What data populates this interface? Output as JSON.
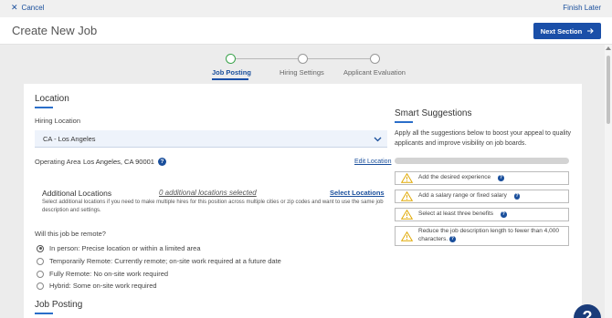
{
  "topbar": {
    "cancel_label": "Cancel",
    "finish_label": "Finish Later"
  },
  "header": {
    "title": "Create New Job",
    "next_label": "Next Section"
  },
  "steps": [
    {
      "label": "Job Posting",
      "state": "active"
    },
    {
      "label": "Hiring Settings",
      "state": "pending"
    },
    {
      "label": "Applicant Evaluation",
      "state": "pending"
    }
  ],
  "location": {
    "title": "Location",
    "hiring_location_label": "Hiring Location",
    "hiring_location_value": "CA - Los Angeles",
    "operating_area_label": "Operating Area",
    "operating_area_value": "Los Angeles, CA 90001",
    "edit_location": "Edit Location",
    "additional_title": "Additional Locations",
    "additional_count": "0 additional locations selected",
    "select_locations": "Select Locations",
    "additional_desc": "Select additional locations if you need to make multiple hires for this position across multiple cities or zip codes and want to use the same job description and settings.",
    "remote_question": "Will this job be remote?",
    "remote_options": [
      {
        "label": "In person: Precise location or within a limited area",
        "checked": true
      },
      {
        "label": "Temporarily Remote: Currently remote; on-site work required at a future date",
        "checked": false
      },
      {
        "label": "Fully Remote: No on-site work required",
        "checked": false
      },
      {
        "label": "Hybrid: Some on-site work required",
        "checked": false
      }
    ]
  },
  "job_posting": {
    "title": "Job Posting"
  },
  "smart": {
    "title": "Smart Suggestions",
    "description": "Apply all the suggestions below to boost your appeal to quality applicants and improve visibility on job boards.",
    "progress": 0,
    "items": [
      "Add the desired experience",
      "Add a salary range or fixed salary",
      "Select at least three benefits",
      "Reduce the job description length to fewer than 4,000 characters."
    ]
  },
  "help": {
    "label": "?"
  },
  "colors": {
    "primary": "#1a4fa8",
    "link": "#1a4f9c",
    "step_active": "#39a34a",
    "warning": "#e0a800"
  },
  "icons": [
    "close-icon",
    "arrow-right-icon",
    "chevron-down-icon",
    "help-icon",
    "warning-icon"
  ]
}
